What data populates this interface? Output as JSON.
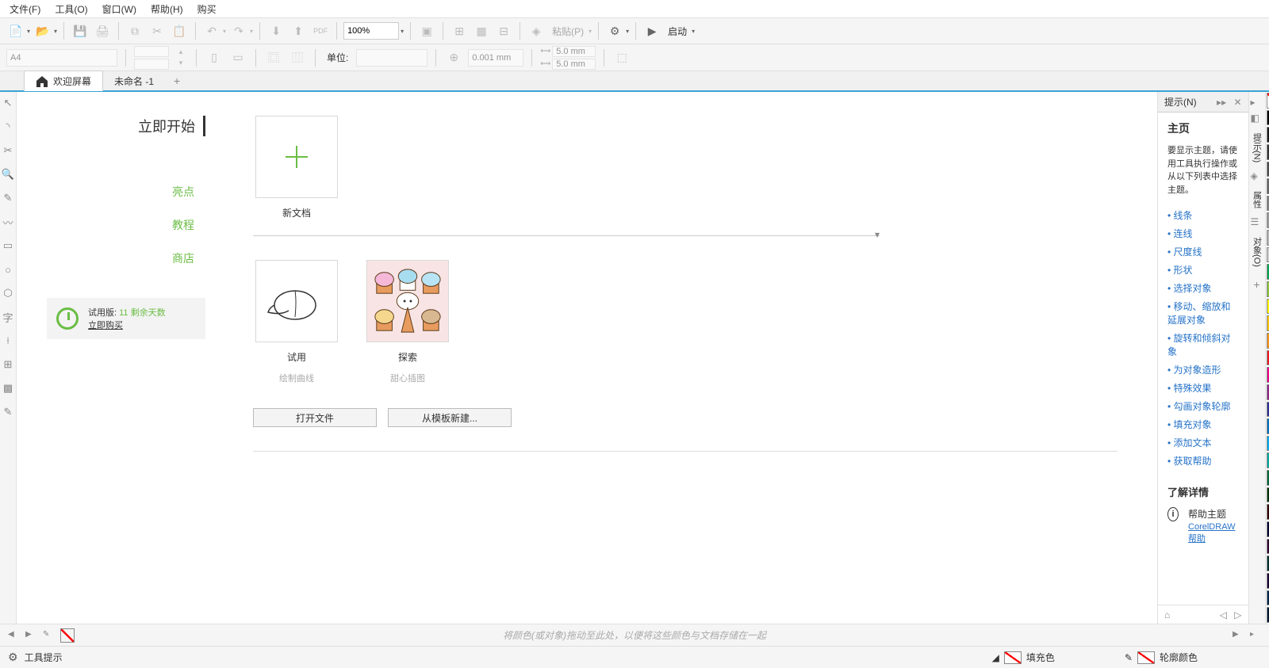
{
  "menu": {
    "file": "文件(F)",
    "tools": "工具(O)",
    "window": "窗口(W)",
    "help": "帮助(H)",
    "buy": "购买"
  },
  "toolbar1": {
    "zoom": "100%",
    "paste": "粘贴(P)",
    "launch": "启动"
  },
  "toolbar2": {
    "page_size": "A4",
    "units_label": "单位:",
    "nudge": "0.001 mm",
    "dup_x": "5.0 mm",
    "dup_y": "5.0 mm"
  },
  "tabs": {
    "welcome": "欢迎屏幕",
    "untitled": "未命名 -1"
  },
  "welcome": {
    "title": "立即开始",
    "nav": {
      "highlights": "亮点",
      "tutorials": "教程",
      "store": "商店"
    },
    "trial": {
      "label": "试用版:",
      "days": "11 剩余天数",
      "buy": "立即购买"
    },
    "tiles": {
      "new_doc": "新文档",
      "trial": "试用",
      "trial_sub": "绘制曲线",
      "explore": "探索",
      "explore_sub": "甜心插图"
    },
    "buttons": {
      "open": "打开文件",
      "template": "从模板新建..."
    }
  },
  "hints": {
    "panel_title": "提示(N)",
    "home": "主页",
    "desc": "要显示主题，请使用工具执行操作或从以下列表中选择主题。",
    "topics": [
      "线条",
      "连线",
      "尺度线",
      "形状",
      "选择对象",
      "移动、缩放和延展对象",
      "旋转和倾斜对象",
      "为对象造形",
      "特殊效果",
      "勾画对象轮廓",
      "填充对象",
      "添加文本",
      "获取帮助"
    ],
    "learn_more": "了解详情",
    "help_topic": "帮助主题",
    "help_link": "CorelDRAW 帮助"
  },
  "docks": {
    "hints": "提示(N)",
    "properties": "属性",
    "objects": "对象(O)"
  },
  "colorstrip_hint": "将颜色(或对象)拖动至此处，以便将这些颜色与文档存储在一起",
  "status": {
    "tool_tips": "工具提示",
    "fill": "填充色",
    "outline": "轮廓颜色"
  },
  "palette": [
    "#000000",
    "#1a1a1a",
    "#333333",
    "#4d4d4d",
    "#666666",
    "#808080",
    "#999999",
    "#b3b3b3",
    "#cccccc",
    "#00a651",
    "#8dc63f",
    "#fff200",
    "#ffc20e",
    "#f7941d",
    "#ed1c24",
    "#ec008c",
    "#92278f",
    "#2e3192",
    "#0072bc",
    "#00aeef",
    "#00a99d",
    "#006838",
    "#003300",
    "#330000",
    "#000033",
    "#330033",
    "#003333",
    "#1a0033",
    "#00264d",
    "#001933"
  ]
}
